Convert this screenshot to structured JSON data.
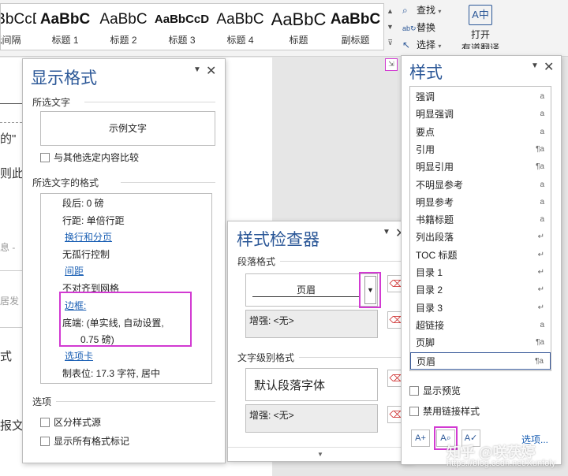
{
  "ribbon": {
    "gallery": [
      {
        "preview": "AaBbCcD",
        "name": "无间隔"
      },
      {
        "preview": "AaBbC",
        "name": "标题 1"
      },
      {
        "preview": "AaBbC",
        "name": "标题 2"
      },
      {
        "preview": "AaBbCcD",
        "name": "标题 3"
      },
      {
        "preview": "AaBbC",
        "name": "标题 4"
      },
      {
        "preview": "AaBbC",
        "name": "标题"
      },
      {
        "preview": "AaBbC",
        "name": "副标题"
      }
    ],
    "find_label": "查找",
    "replace_label": "替换",
    "select_label": "选择",
    "translate_label_1": "打开",
    "translate_label_2": "有道翻译"
  },
  "document": {
    "snippets": [
      "的\"",
      "则此",
      "息 -",
      "居发",
      "式",
      "报文"
    ]
  },
  "reveal_formatting": {
    "title": "显示格式",
    "selected_text_label": "所选文字",
    "sample_text": "示例文字",
    "compare_label": "与其他选定内容比较",
    "format_label": "所选文字的格式",
    "rows": [
      {
        "text": "段后: 0 磅",
        "link": false
      },
      {
        "text": "行距: 单倍行距",
        "link": false
      },
      {
        "text": "换行和分页",
        "link": true
      },
      {
        "text": "无孤行控制",
        "link": false
      },
      {
        "text": "间距",
        "link": true
      },
      {
        "text": "不对齐到网格",
        "link": false
      },
      {
        "text": "边框:",
        "link": true
      },
      {
        "text": "底端: (单实线, 自动设置,",
        "link": false
      },
      {
        "text": "0.75 磅)",
        "link": false
      },
      {
        "text": "选项卡",
        "link": true
      },
      {
        "text": "制表位: 17.3 字符, 居中",
        "link": false
      }
    ],
    "options_label": "选项",
    "distinguish_label": "区分样式源",
    "show_marks_label": "显示所有格式标记"
  },
  "style_inspector": {
    "title": "样式检查器",
    "paragraph_label": "段落格式",
    "paragraph_style": "页眉",
    "paragraph_plus": "增强: <无>",
    "text_level_label": "文字级别格式",
    "text_style": "默认段落字体",
    "text_plus": "增强: <无>"
  },
  "styles_pane": {
    "title": "样式",
    "items": [
      {
        "name": "强调",
        "mark": "a"
      },
      {
        "name": "明显强调",
        "mark": "a"
      },
      {
        "name": "要点",
        "mark": "a"
      },
      {
        "name": "引用",
        "mark": "¶a"
      },
      {
        "name": "明显引用",
        "mark": "¶a"
      },
      {
        "name": "不明显参考",
        "mark": "a"
      },
      {
        "name": "明显参考",
        "mark": "a"
      },
      {
        "name": "书籍标题",
        "mark": "a"
      },
      {
        "name": "列出段落",
        "mark": "↵"
      },
      {
        "name": "TOC 标题",
        "mark": "↵"
      },
      {
        "name": "目录 1",
        "mark": "↵"
      },
      {
        "name": "目录 2",
        "mark": "↵"
      },
      {
        "name": "目录 3",
        "mark": "↵"
      },
      {
        "name": "超链接",
        "mark": "a"
      },
      {
        "name": "页脚",
        "mark": "¶a"
      },
      {
        "name": "页眉",
        "mark": "¶a"
      }
    ],
    "show_preview_label": "显示预览",
    "disable_linked_label": "禁用链接样式",
    "options_link": "选项..."
  },
  "watermark": {
    "brand": "知乎 @咲茯婷",
    "url": "https://blog.csdn.net/Xunfoly"
  },
  "colors": {
    "accent": "#2b5797",
    "highlight": "#d23ad2",
    "link": "#1a5fb4"
  }
}
